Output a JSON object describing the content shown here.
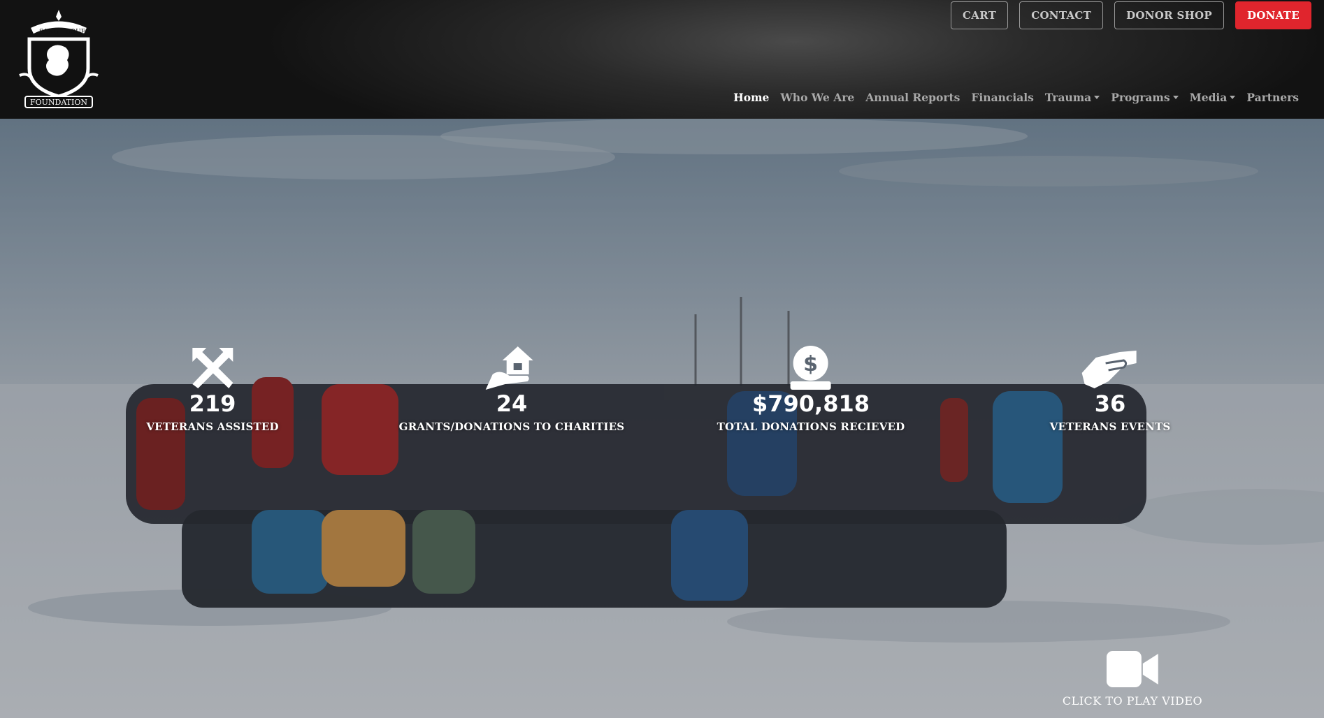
{
  "header": {
    "logo": {
      "name": "sandboxx foundation crest logo",
      "banner_left": "SANG",
      "banner_right": "BOUE",
      "scroll": "FOUNDATION"
    },
    "top_buttons": [
      {
        "label": "CART"
      },
      {
        "label": "CONTACT"
      },
      {
        "label": "DONOR SHOP"
      },
      {
        "label": "DONATE",
        "color": "#e0252d"
      }
    ],
    "nav": [
      {
        "label": "Home",
        "active": true
      },
      {
        "label": "Who We Are"
      },
      {
        "label": "Annual Reports"
      },
      {
        "label": "Financials"
      },
      {
        "label": "Trauma",
        "dropdown": true
      },
      {
        "label": "Programs",
        "dropdown": true
      },
      {
        "label": "Media",
        "dropdown": true
      },
      {
        "label": "Partners"
      }
    ]
  },
  "stats": [
    {
      "icon": "crossed-arrows-icon",
      "value": "219",
      "label": "VETERANS ASSISTED"
    },
    {
      "icon": "house-in-hand-icon",
      "value": "24",
      "label": "GRANTS/DONATIONS TO CHARITIES"
    },
    {
      "icon": "coin-donation-icon",
      "value": "$790,818",
      "label": "TOTAL DONATIONS RECIEVED"
    },
    {
      "icon": "handshake-icon",
      "value": "36",
      "label": "VETERANS EVENTS"
    }
  ],
  "video": {
    "icon": "video-camera-icon",
    "label": "CLICK TO PLAY VIDEO"
  },
  "colors": {
    "accent": "#e0252d",
    "header_dark": "#121212",
    "nav_text": "#a9a9a9"
  }
}
